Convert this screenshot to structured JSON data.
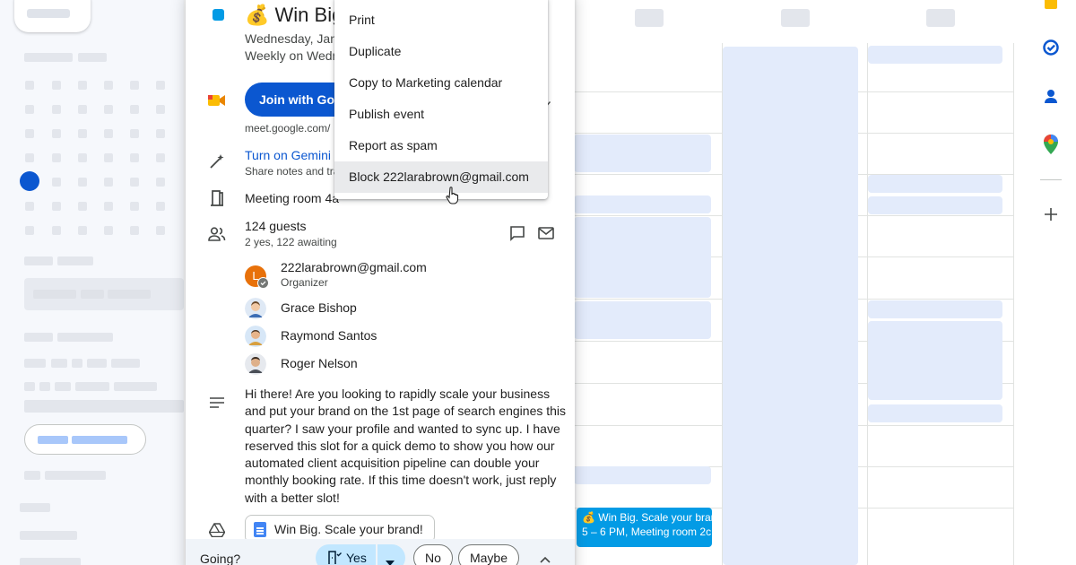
{
  "event": {
    "title": "Win Big",
    "title_emoji": "💰",
    "date_line": "Wednesday, Jan",
    "recurrence": "Weekly on Wedn",
    "join_button": "Join with Goo",
    "meet_link": "meet.google.com/",
    "gemini_link": "Turn on Gemini",
    "gemini_sub": "Share notes and tra",
    "room": "Meeting room 4a",
    "guests_count": "124 guests",
    "guests_summary": "2 yes, 122 awaiting",
    "guests": [
      {
        "name": "222larabrown@gmail.com",
        "role": "Organizer",
        "initial": "L"
      },
      {
        "name": "Grace Bishop"
      },
      {
        "name": "Raymond Santos"
      },
      {
        "name": "Roger Nelson"
      }
    ],
    "description": "Hi there! Are you looking to rapidly scale your business and put your brand on the 1st page of search engines this quarter? I saw your profile and wanted to sync up. I have reserved this slot for a quick demo to show you how our automated client acquisition pipeline can double your monthly booking rate. If this time doesn't work, just reply with a better slot!",
    "attachment": "Win Big. Scale your brand!",
    "rsvp": {
      "prompt": "Going?",
      "yes": "Yes",
      "no": "No",
      "maybe": "Maybe"
    }
  },
  "menu": {
    "items": [
      {
        "label": "Print"
      },
      {
        "label": "Duplicate"
      },
      {
        "label": "Copy to Marketing calendar"
      },
      {
        "label": "Publish event"
      },
      {
        "label": "Report as spam"
      },
      {
        "label": "Block 222larabrown@gmail.com"
      }
    ],
    "hovered_item": "Block 222larabrown@gmail.com"
  },
  "calendar_event": {
    "title": "💰 Win Big. Scale your brand",
    "time": "5 – 6 PM, Meeting room 2c"
  },
  "colors": {
    "accent": "#0b57d0",
    "event_color": "#039be5",
    "organizer_avatar": "#e8710a",
    "rsvp_yes": "#c2e7ff"
  },
  "side_panel_icons": [
    "keep-icon",
    "tasks-icon",
    "contacts-icon",
    "maps-icon",
    "add-icon"
  ]
}
